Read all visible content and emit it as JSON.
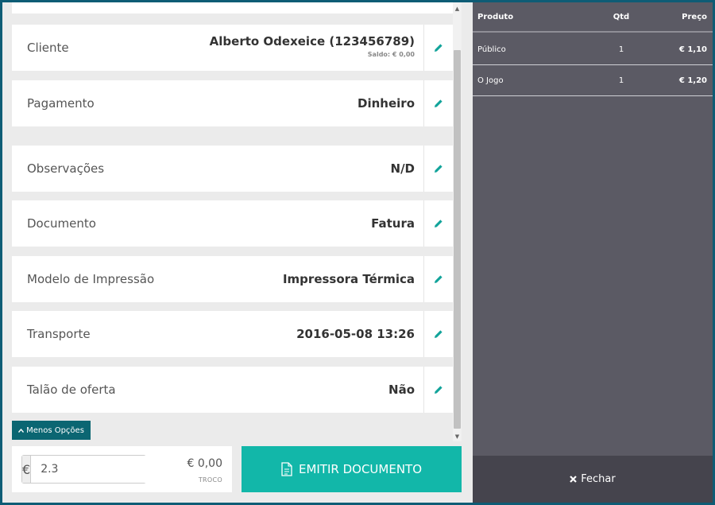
{
  "form": {
    "rows": [
      {
        "label": "Cliente",
        "value": "Alberto Odexeice (123456789)",
        "sub": "Saldo: € 0,00"
      },
      {
        "label": "Pagamento",
        "value": "Dinheiro"
      },
      {
        "label": "Observações",
        "value": "N/D"
      },
      {
        "label": "Documento",
        "value": "Fatura"
      },
      {
        "label": "Modelo de Impressão",
        "value": "Impressora Térmica"
      },
      {
        "label": "Transporte",
        "value": "2016-05-08 13:26"
      },
      {
        "label": "Talão de oferta",
        "value": "Não"
      }
    ],
    "less_options_label": "Menos Opções"
  },
  "payment": {
    "currency_symbol": "€",
    "amount_value": "2.3",
    "change_value": "€ 0,00",
    "change_label": "TROCO"
  },
  "emit_button_label": "EMITIR DOCUMENTO",
  "products": {
    "headers": {
      "product": "Produto",
      "qty": "Qtd",
      "price": "Preço"
    },
    "rows": [
      {
        "product": "Público",
        "qty": "1",
        "price": "€ 1,10"
      },
      {
        "product": "O Jogo",
        "qty": "1",
        "price": "€ 1,20"
      }
    ]
  },
  "close_label": "Fechar",
  "colors": {
    "accent": "#12b7a9",
    "dark_teal": "#0b6672",
    "panel": "#5b5a64",
    "edit_icon": "#11a39a"
  }
}
